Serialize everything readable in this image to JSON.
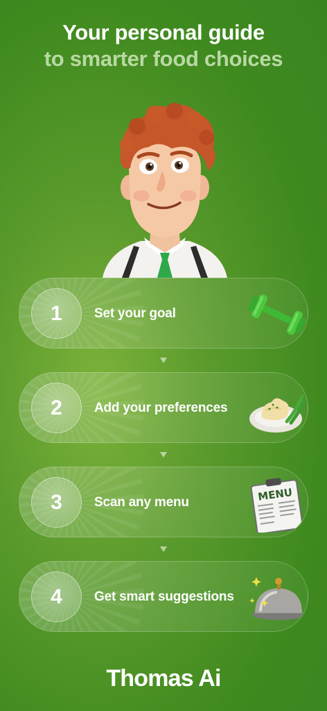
{
  "header": {
    "title": "Your personal guide",
    "subtitle": "to smarter food choices"
  },
  "mascot": {
    "icon": "chef-mascot-illustration"
  },
  "steps": [
    {
      "number": "1",
      "label": "Set your goal",
      "icon": "dumbbell-icon"
    },
    {
      "number": "2",
      "label": "Add your preferences",
      "icon": "mashed-potato-plate-icon"
    },
    {
      "number": "3",
      "label": "Scan any menu",
      "icon": "menu-clipboard-icon",
      "icon_text": "MENU"
    },
    {
      "number": "4",
      "label": "Get smart suggestions",
      "icon": "serving-cloche-icon"
    }
  ],
  "brand": {
    "name": "Thomas Ai"
  },
  "colors": {
    "background": "#4a9326",
    "subtitle": "#b8d9a3",
    "dumbbell": "#4cc93b"
  }
}
